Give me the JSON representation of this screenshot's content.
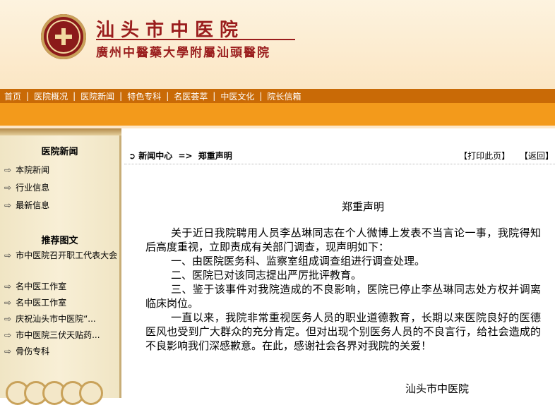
{
  "header": {
    "name": "汕头市中医院",
    "subtitle": "廣州中醫藥大學附屬汕頭醫院"
  },
  "nav": {
    "items": [
      "首页",
      "医院概况",
      "医院新闻",
      "特色专科",
      "名医荟萃",
      "中医文化",
      "院长信箱"
    ],
    "separator": "|"
  },
  "sidebar": {
    "news_title": "医院新闻",
    "news_items": [
      "本院新闻",
      "行业信息",
      "最新信息"
    ],
    "rec_title": "推荐图文",
    "rec_items": [
      "市中医院召开职工代表大会",
      "名中医工作室",
      "名中医工作室",
      "庆祝汕头市中医院“...",
      "市中医院三伏天贴药...",
      "骨伤专科"
    ]
  },
  "content": {
    "breadcrumb": {
      "icon": "circular-arrow-icon",
      "section": "新闻中心",
      "arrow": "=>",
      "current": "郑重声明"
    },
    "print_label": "【打印此页】",
    "back_label": "【返回】",
    "article": {
      "title": "郑重声明",
      "paragraphs": [
        "关于近日我院聘用人员李丛琳同志在个人微博上发表不当言论一事，我院得知后高度重视，立即责成有关部门调查，现声明如下：",
        "一、由医院医务科、监察室组成调查组进行调查处理。",
        "二、医院已对该同志提出严厉批评教育。",
        "三、鉴于该事件对我院造成的不良影响，医院已停止李丛琳同志处方权并调离临床岗位。",
        "一直以来，我院非常重视医务人员的职业道德教育，长期以来医院良好的医德医风也受到广大群众的充分肯定。但对出现个别医务人员的不良言行，给社会造成的不良影响我们深感歉意。在此，感谢社会各界对我院的关爱！"
      ],
      "signature": "汕头市中医院"
    }
  },
  "colors": {
    "nav_bg": "#c96a06",
    "band_bg": "#f39a1b",
    "brand_red": "#9a1d1d"
  }
}
